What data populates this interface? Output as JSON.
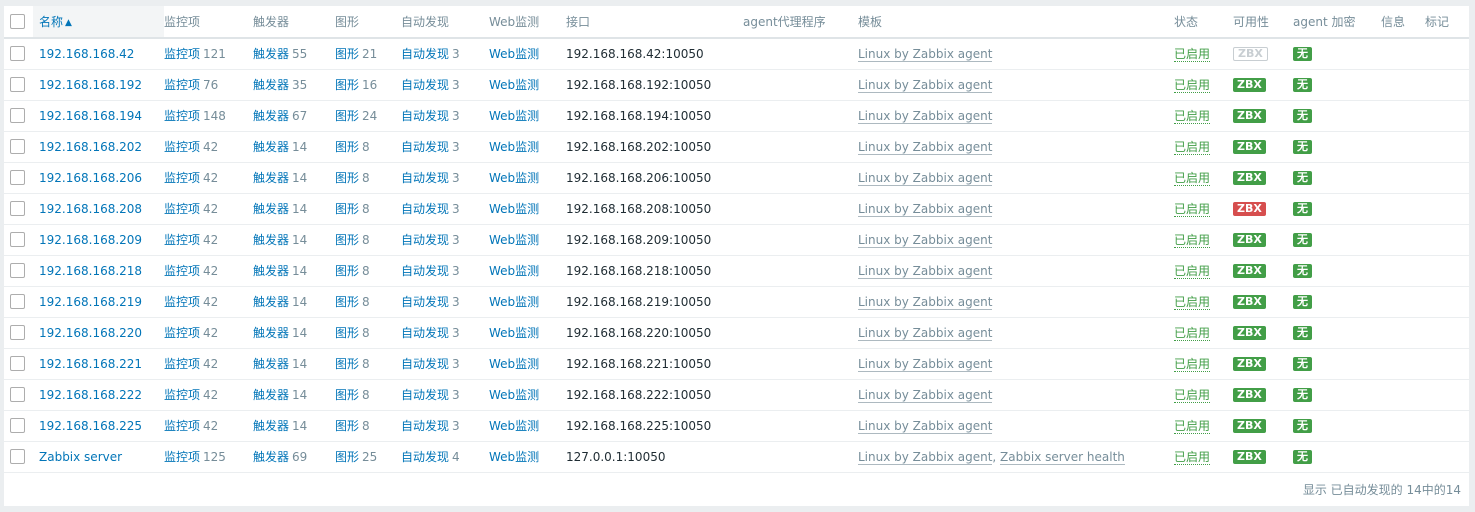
{
  "columns": {
    "name": "名称",
    "items": "监控项",
    "triggers": "触发器",
    "graphs": "图形",
    "discovery": "自动发现",
    "web": "Web监测",
    "interface": "接口",
    "proxy": "agent代理程序",
    "templates": "模板",
    "status": "状态",
    "availability": "可用性",
    "encryption": "agent 加密",
    "info": "信息",
    "tags": "标记"
  },
  "rows": [
    {
      "name": "192.168.168.42",
      "items_label": "监控项",
      "items": "121",
      "triggers_label": "触发器",
      "triggers": "55",
      "graphs_label": "图形",
      "graphs": "21",
      "discovery_label": "自动发现",
      "discovery": "3",
      "web": "Web监测",
      "interface": "192.168.168.42:10050",
      "templates": [
        "Linux by Zabbix agent"
      ],
      "status": "已启用",
      "availability": "ZBX",
      "availability_state": "gray",
      "encryption": "无"
    },
    {
      "name": "192.168.168.192",
      "items_label": "监控项",
      "items": "76",
      "triggers_label": "触发器",
      "triggers": "35",
      "graphs_label": "图形",
      "graphs": "16",
      "discovery_label": "自动发现",
      "discovery": "3",
      "web": "Web监测",
      "interface": "192.168.168.192:10050",
      "templates": [
        "Linux by Zabbix agent"
      ],
      "status": "已启用",
      "availability": "ZBX",
      "availability_state": "green",
      "encryption": "无"
    },
    {
      "name": "192.168.168.194",
      "items_label": "监控项",
      "items": "148",
      "triggers_label": "触发器",
      "triggers": "67",
      "graphs_label": "图形",
      "graphs": "24",
      "discovery_label": "自动发现",
      "discovery": "3",
      "web": "Web监测",
      "interface": "192.168.168.194:10050",
      "templates": [
        "Linux by Zabbix agent"
      ],
      "status": "已启用",
      "availability": "ZBX",
      "availability_state": "green",
      "encryption": "无"
    },
    {
      "name": "192.168.168.202",
      "items_label": "监控项",
      "items": "42",
      "triggers_label": "触发器",
      "triggers": "14",
      "graphs_label": "图形",
      "graphs": "8",
      "discovery_label": "自动发现",
      "discovery": "3",
      "web": "Web监测",
      "interface": "192.168.168.202:10050",
      "templates": [
        "Linux by Zabbix agent"
      ],
      "status": "已启用",
      "availability": "ZBX",
      "availability_state": "green",
      "encryption": "无"
    },
    {
      "name": "192.168.168.206",
      "items_label": "监控项",
      "items": "42",
      "triggers_label": "触发器",
      "triggers": "14",
      "graphs_label": "图形",
      "graphs": "8",
      "discovery_label": "自动发现",
      "discovery": "3",
      "web": "Web监测",
      "interface": "192.168.168.206:10050",
      "templates": [
        "Linux by Zabbix agent"
      ],
      "status": "已启用",
      "availability": "ZBX",
      "availability_state": "green",
      "encryption": "无"
    },
    {
      "name": "192.168.168.208",
      "items_label": "监控项",
      "items": "42",
      "triggers_label": "触发器",
      "triggers": "14",
      "graphs_label": "图形",
      "graphs": "8",
      "discovery_label": "自动发现",
      "discovery": "3",
      "web": "Web监测",
      "interface": "192.168.168.208:10050",
      "templates": [
        "Linux by Zabbix agent"
      ],
      "status": "已启用",
      "availability": "ZBX",
      "availability_state": "red",
      "encryption": "无"
    },
    {
      "name": "192.168.168.209",
      "items_label": "监控项",
      "items": "42",
      "triggers_label": "触发器",
      "triggers": "14",
      "graphs_label": "图形",
      "graphs": "8",
      "discovery_label": "自动发现",
      "discovery": "3",
      "web": "Web监测",
      "interface": "192.168.168.209:10050",
      "templates": [
        "Linux by Zabbix agent"
      ],
      "status": "已启用",
      "availability": "ZBX",
      "availability_state": "green",
      "encryption": "无"
    },
    {
      "name": "192.168.168.218",
      "items_label": "监控项",
      "items": "42",
      "triggers_label": "触发器",
      "triggers": "14",
      "graphs_label": "图形",
      "graphs": "8",
      "discovery_label": "自动发现",
      "discovery": "3",
      "web": "Web监测",
      "interface": "192.168.168.218:10050",
      "templates": [
        "Linux by Zabbix agent"
      ],
      "status": "已启用",
      "availability": "ZBX",
      "availability_state": "green",
      "encryption": "无"
    },
    {
      "name": "192.168.168.219",
      "items_label": "监控项",
      "items": "42",
      "triggers_label": "触发器",
      "triggers": "14",
      "graphs_label": "图形",
      "graphs": "8",
      "discovery_label": "自动发现",
      "discovery": "3",
      "web": "Web监测",
      "interface": "192.168.168.219:10050",
      "templates": [
        "Linux by Zabbix agent"
      ],
      "status": "已启用",
      "availability": "ZBX",
      "availability_state": "green",
      "encryption": "无"
    },
    {
      "name": "192.168.168.220",
      "items_label": "监控项",
      "items": "42",
      "triggers_label": "触发器",
      "triggers": "14",
      "graphs_label": "图形",
      "graphs": "8",
      "discovery_label": "自动发现",
      "discovery": "3",
      "web": "Web监测",
      "interface": "192.168.168.220:10050",
      "templates": [
        "Linux by Zabbix agent"
      ],
      "status": "已启用",
      "availability": "ZBX",
      "availability_state": "green",
      "encryption": "无"
    },
    {
      "name": "192.168.168.221",
      "items_label": "监控项",
      "items": "42",
      "triggers_label": "触发器",
      "triggers": "14",
      "graphs_label": "图形",
      "graphs": "8",
      "discovery_label": "自动发现",
      "discovery": "3",
      "web": "Web监测",
      "interface": "192.168.168.221:10050",
      "templates": [
        "Linux by Zabbix agent"
      ],
      "status": "已启用",
      "availability": "ZBX",
      "availability_state": "green",
      "encryption": "无"
    },
    {
      "name": "192.168.168.222",
      "items_label": "监控项",
      "items": "42",
      "triggers_label": "触发器",
      "triggers": "14",
      "graphs_label": "图形",
      "graphs": "8",
      "discovery_label": "自动发现",
      "discovery": "3",
      "web": "Web监测",
      "interface": "192.168.168.222:10050",
      "templates": [
        "Linux by Zabbix agent"
      ],
      "status": "已启用",
      "availability": "ZBX",
      "availability_state": "green",
      "encryption": "无"
    },
    {
      "name": "192.168.168.225",
      "items_label": "监控项",
      "items": "42",
      "triggers_label": "触发器",
      "triggers": "14",
      "graphs_label": "图形",
      "graphs": "8",
      "discovery_label": "自动发现",
      "discovery": "3",
      "web": "Web监测",
      "interface": "192.168.168.225:10050",
      "templates": [
        "Linux by Zabbix agent"
      ],
      "status": "已启用",
      "availability": "ZBX",
      "availability_state": "green",
      "encryption": "无"
    },
    {
      "name": "Zabbix server",
      "items_label": "监控项",
      "items": "125",
      "triggers_label": "触发器",
      "triggers": "69",
      "graphs_label": "图形",
      "graphs": "25",
      "discovery_label": "自动发现",
      "discovery": "4",
      "web": "Web监测",
      "interface": "127.0.0.1:10050",
      "templates": [
        "Linux by Zabbix agent",
        "Zabbix server health"
      ],
      "status": "已启用",
      "availability": "ZBX",
      "availability_state": "green",
      "encryption": "无"
    }
  ],
  "template_separator": ", ",
  "footer": "显示 已自动发现的 14中的14",
  "colors": {
    "link": "#0275b8",
    "status_enabled": "#429e47",
    "badge_ok": "#429e47",
    "badge_error": "#d64e4e",
    "badge_unknown": "#c8ced2"
  },
  "icons": {
    "sort": "sort-ascending-icon"
  }
}
